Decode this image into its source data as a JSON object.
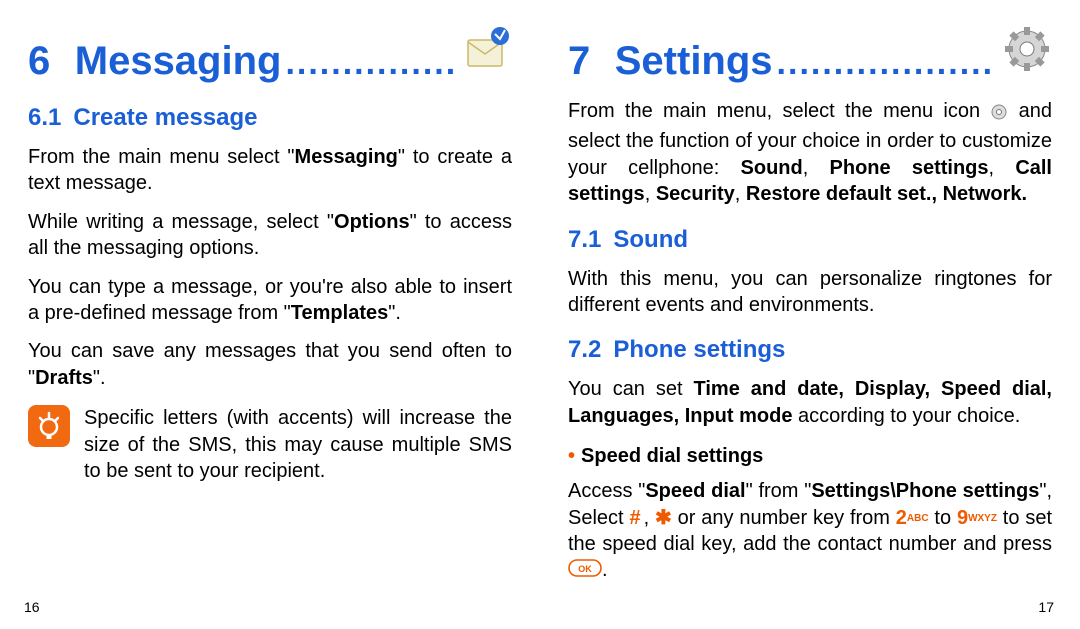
{
  "left": {
    "chapter_num": "6",
    "chapter_title": "Messaging",
    "section1_num": "6.1",
    "section1_title": "Create message",
    "page_num": "16"
  },
  "right": {
    "chapter_num": "7",
    "chapter_title": "Settings",
    "section1_num": "7.1",
    "section1_title": "Sound",
    "section2_num": "7.2",
    "section2_title": "Phone settings",
    "bullet1_title": "Speed dial settings",
    "page_num": "17"
  },
  "text": {
    "l_p1_a": "From the main menu select \"",
    "l_p1_b": "Messaging",
    "l_p1_c": "\" to create a text message.",
    "l_p2_a": "While writing a message, select \"",
    "l_p2_b": "Options",
    "l_p2_c": "\" to access all the messaging options.",
    "l_p3_a": "You can type a message, or you're also able to insert a pre-defined message from \"",
    "l_p3_b": "Templates",
    "l_p3_c": "\".",
    "l_p4_a": "You can save any messages that you send often to \"",
    "l_p4_b": "Drafts",
    "l_p4_c": "\".",
    "l_note": "Specific letters (with accents) will increase the size of the SMS, this may cause multiple SMS to be sent to your recipient.",
    "r_p1_a": "From the main menu, select the menu icon ",
    "r_p1_b": " and select the function of your choice in order to customize your cellphone: ",
    "r_p1_c": "Sound",
    "r_p1_d": "Phone settings",
    "r_p1_e": "Call settings",
    "r_p1_f": "Security",
    "r_p1_g": "Restore default set., Network.",
    "r_p2": "With this menu, you can personalize ringtones for different events and environments.",
    "r_p3_a": "You can set ",
    "r_p3_b": "Time and date, Display, Speed dial, Languages, Input mode",
    "r_p3_c": " according to your choice.",
    "r_p4_a": "Access \"",
    "r_p4_b": "Speed dial",
    "r_p4_c": "\" from \"",
    "r_p4_d": "Settings\\Phone settings",
    "r_p4_e": "\", Select ",
    "r_p4_f": " or any number key from ",
    "r_p4_g": " to ",
    "r_p4_h": " to set the speed dial key, add the contact number and press ",
    "key2": "2",
    "key2sub": "ABC",
    "key9": "9",
    "key9sub": "WXYZ",
    "ok": "OK"
  }
}
